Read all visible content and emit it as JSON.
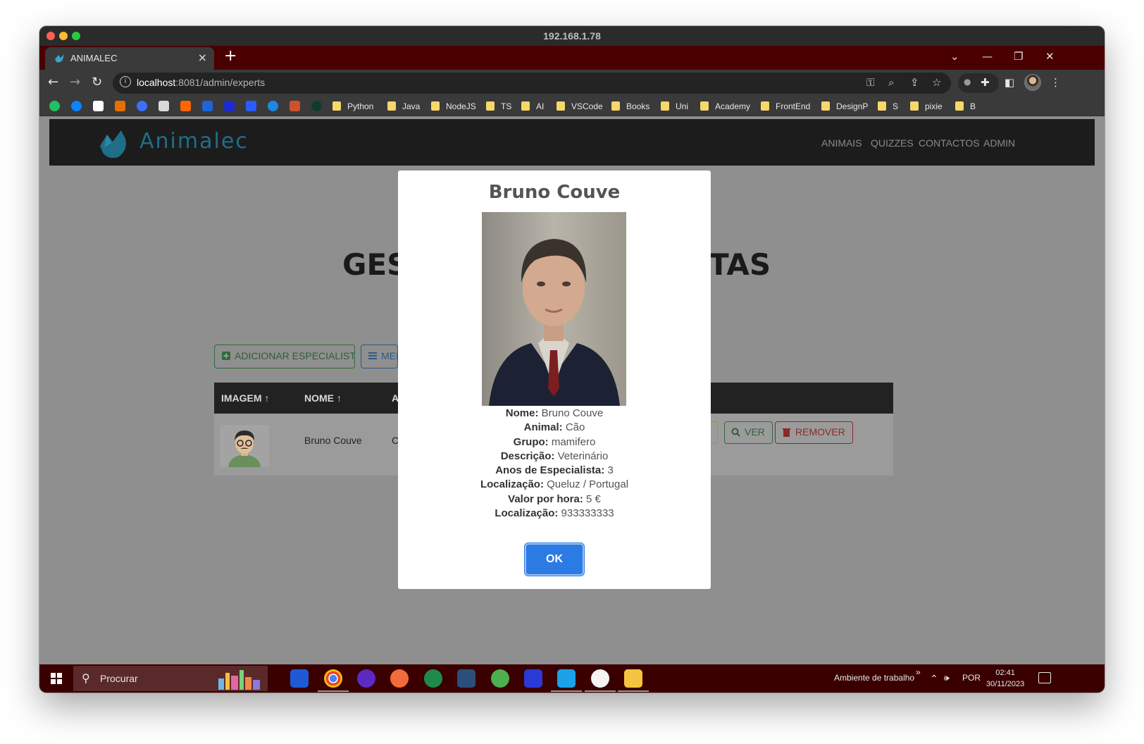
{
  "window": {
    "title": "192.168.1.78"
  },
  "tab": {
    "title": "ANIMALEC",
    "close": "×",
    "new": "+"
  },
  "window_controls": {
    "dropdown": "⌄",
    "minimize": "—",
    "restore": "❐",
    "close": "✕"
  },
  "address_bar": {
    "host": "localhost",
    "rest": ":8081/admin/experts"
  },
  "bookmarks": [
    "Python",
    "Java",
    "NodeJS",
    "TS",
    "AI",
    "VSCode",
    "Books",
    "Uni",
    "Academy",
    "FrontEnd",
    "DesignP",
    "S",
    "pixie",
    "B"
  ],
  "site": {
    "brand": "Animalec",
    "nav": [
      "ANIMAIS",
      "QUIZZES",
      "CONTACTOS",
      "ADMIN"
    ],
    "heading_left": "GES",
    "heading_right": "TAS",
    "add_button": "ADICIONAR ESPECIALISTA",
    "menu_button": "MEN",
    "table": {
      "headers": [
        "IMAGEM",
        "NOME",
        "AN"
      ],
      "row": {
        "name": "Bruno Couve",
        "animal": "Câ",
        "view_button": "VER",
        "remove_button": "REMOVER"
      }
    }
  },
  "modal": {
    "title": "Bruno Couve",
    "fields": [
      {
        "label": "Nome:",
        "value": "Bruno Couve"
      },
      {
        "label": "Animal:",
        "value": "Cão"
      },
      {
        "label": "Grupo:",
        "value": "mamifero"
      },
      {
        "label": "Descrição:",
        "value": "Veterinário"
      },
      {
        "label": "Anos de Especialista:",
        "value": "3"
      },
      {
        "label": "Localização:",
        "value": "Queluz / Portugal"
      },
      {
        "label": "Valor por hora:",
        "value": "5 €"
      },
      {
        "label": "Localização:",
        "value": "933333333"
      }
    ],
    "ok_button": "OK"
  },
  "taskbar": {
    "search_placeholder": "Procurar",
    "desktop_label": "Ambiente de trabalho",
    "chevron": "»",
    "language": "POR",
    "time": "02:41",
    "date": "30/11/2023"
  },
  "colors": {
    "accent": "#2c7be5",
    "brand": "#1f6e88",
    "tab_strip": "#4a0000",
    "taskbar": "#3a0000"
  }
}
